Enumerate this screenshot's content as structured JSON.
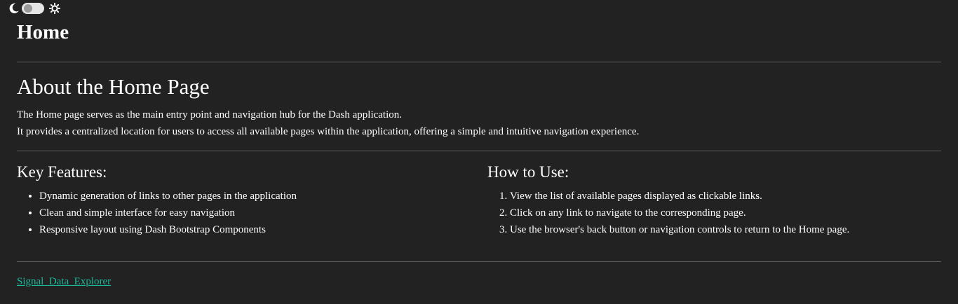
{
  "theme_switch": {
    "left_icon": "moon-icon",
    "right_icon": "sun-icon",
    "state": "off"
  },
  "page": {
    "title": "Home"
  },
  "about": {
    "title": "About the Home Page",
    "lines": [
      "The Home page serves as the main entry point and navigation hub for the Dash application.",
      "It provides a centralized location for users to access all available pages within the application, offering a simple and intuitive navigation experience."
    ]
  },
  "key_features": {
    "title": "Key Features:",
    "items": [
      "Dynamic generation of links to other pages in the application",
      "Clean and simple interface for easy navigation",
      "Responsive layout using Dash Bootstrap Components"
    ]
  },
  "how_to_use": {
    "title": "How to Use:",
    "items": [
      "View the list of available pages displayed as clickable links.",
      "Click on any link to navigate to the corresponding page.",
      "Use the browser's back button or navigation controls to return to the Home page."
    ]
  },
  "links": [
    {
      "label": "Signal_Data_Explorer"
    }
  ],
  "colors": {
    "background": "#222222",
    "text": "#ffffff",
    "link": "#1bbc9b",
    "divider": "#5a5a5a"
  }
}
